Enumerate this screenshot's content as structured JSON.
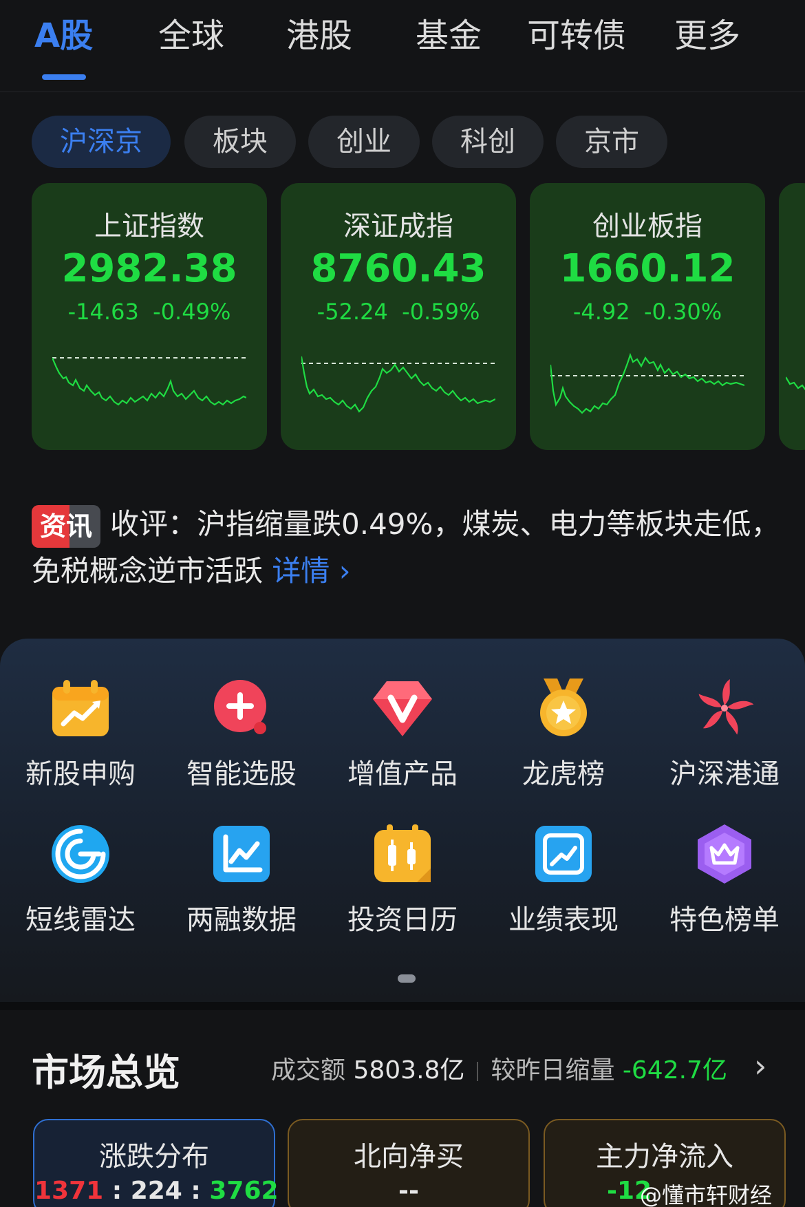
{
  "top_tabs": [
    {
      "label": "A股",
      "active": true
    },
    {
      "label": "全球"
    },
    {
      "label": "港股"
    },
    {
      "label": "基金"
    },
    {
      "label": "可转债"
    },
    {
      "label": "更多"
    }
  ],
  "sub_tabs": [
    {
      "label": "沪深京",
      "active": true
    },
    {
      "label": "板块"
    },
    {
      "label": "创业"
    },
    {
      "label": "科创"
    },
    {
      "label": "京市"
    }
  ],
  "indices": [
    {
      "name": "上证指数",
      "value": "2982.38",
      "change": "-14.63  -0.49%",
      "sparkline_color": "#1fdc43"
    },
    {
      "name": "深证成指",
      "value": "8760.43",
      "change": "-52.24  -0.59%",
      "sparkline_color": "#1fdc43"
    },
    {
      "name": "创业板指",
      "value": "1660.12",
      "change": "-4.92  -0.30%",
      "sparkline_color": "#1fdc43"
    }
  ],
  "news": {
    "badge": "资讯",
    "text": "收评：沪指缩量跌0.49%，煤炭、电力等板块走低，免税概念逆市活跃",
    "link": "详情 ›"
  },
  "features": [
    {
      "label": "新股申购",
      "icon": "calendar-chart-icon"
    },
    {
      "label": "智能选股",
      "icon": "plus-search-icon"
    },
    {
      "label": "增值产品",
      "icon": "diamond-v-icon"
    },
    {
      "label": "龙虎榜",
      "icon": "medal-star-icon"
    },
    {
      "label": "沪深港通",
      "icon": "bauhinia-icon"
    },
    {
      "label": "短线雷达",
      "icon": "radar-icon"
    },
    {
      "label": "两融数据",
      "icon": "line-chart-icon"
    },
    {
      "label": "投资日历",
      "icon": "candlestick-calendar-icon"
    },
    {
      "label": "业绩表现",
      "icon": "trend-frame-icon"
    },
    {
      "label": "特色榜单",
      "icon": "crown-hexagon-icon"
    }
  ],
  "market_overview": {
    "title": "市场总览",
    "turnover_label": "成交额",
    "turnover_value": "5803.8亿",
    "compare_label": "较昨日缩量",
    "compare_value": "-642.7亿",
    "cards": [
      {
        "title": "涨跌分布",
        "up": "1371",
        "flat": "224",
        "down": "3762",
        "sep": ":"
      },
      {
        "title": "北向净买",
        "value": "--"
      },
      {
        "title": "主力净流入",
        "value": "-12"
      }
    ]
  },
  "watermark": "@懂市轩财经",
  "colors": {
    "accent": "#3b7ff0",
    "down": "#1fdc43",
    "up": "#f0343b"
  }
}
